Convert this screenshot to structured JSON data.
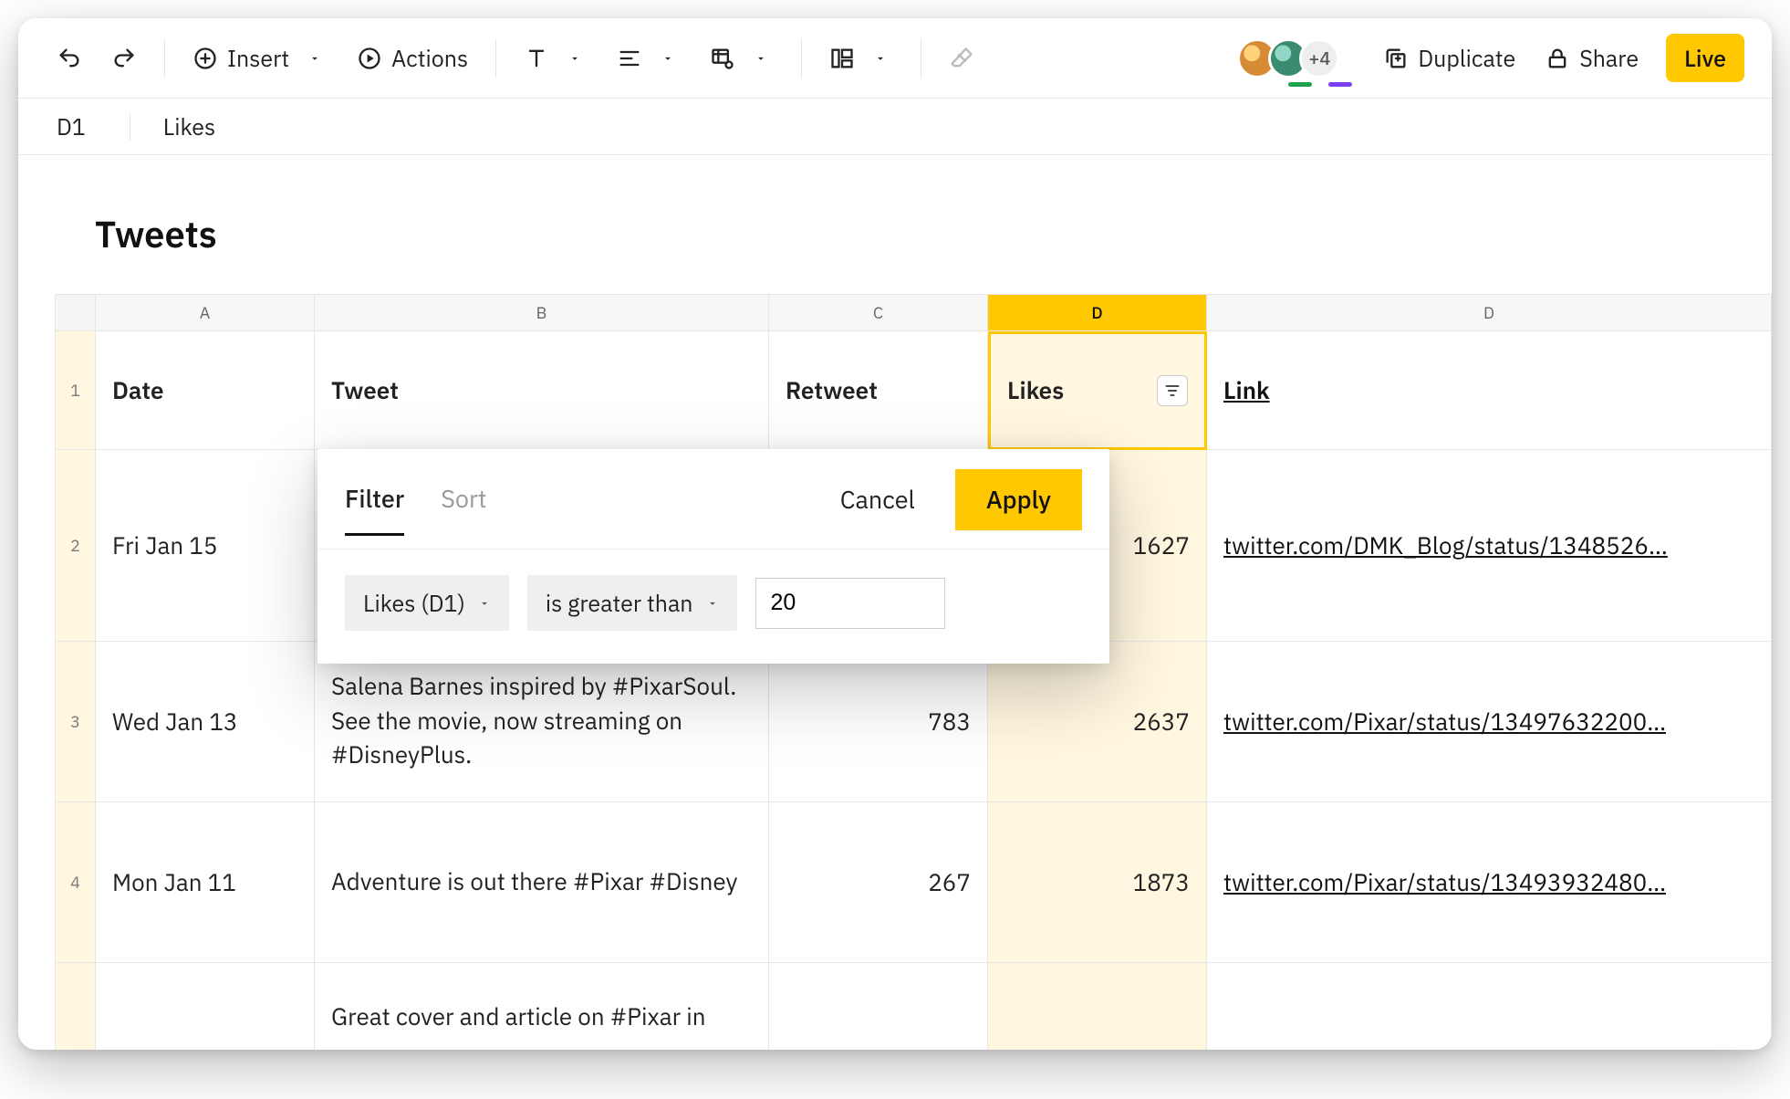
{
  "toolbar": {
    "insert_label": "Insert",
    "actions_label": "Actions",
    "duplicate_label": "Duplicate",
    "share_label": "Share",
    "live_label": "Live",
    "avatar_more": "+4"
  },
  "refbar": {
    "cell": "D1",
    "value": "Likes"
  },
  "sheet": {
    "title": "Tweets",
    "col_letters": [
      "A",
      "B",
      "C",
      "D",
      "D"
    ],
    "headers": {
      "date": "Date",
      "tweet": "Tweet",
      "retweet": "Retweet",
      "likes": "Likes",
      "link": "Link"
    },
    "rows": [
      {
        "num": "2",
        "date": "Fri Jan 15",
        "tweet": "",
        "retweet": "",
        "likes": "1627",
        "link": "twitter.com/DMK_Blog/status/1348526…"
      },
      {
        "num": "3",
        "date": "Wed Jan 13",
        "tweet": "Salena Barnes inspired by #PixarSoul. See the movie, now streaming on #DisneyPlus.",
        "retweet": "783",
        "likes": "2637",
        "link": "twitter.com/Pixar/status/13497632200…"
      },
      {
        "num": "4",
        "date": "Mon Jan 11",
        "tweet": "Adventure is out there #Pixar #Disney",
        "retweet": "267",
        "likes": "1873",
        "link": "twitter.com/Pixar/status/13493932480…"
      },
      {
        "num": "",
        "date": "",
        "tweet": "Great cover and article on #Pixar in",
        "retweet": "",
        "likes": "",
        "link": ""
      }
    ]
  },
  "popover": {
    "tab_filter": "Filter",
    "tab_sort": "Sort",
    "cancel": "Cancel",
    "apply": "Apply",
    "column_dd": "Likes (D1)",
    "op_dd": "is greater than",
    "value": "20"
  }
}
